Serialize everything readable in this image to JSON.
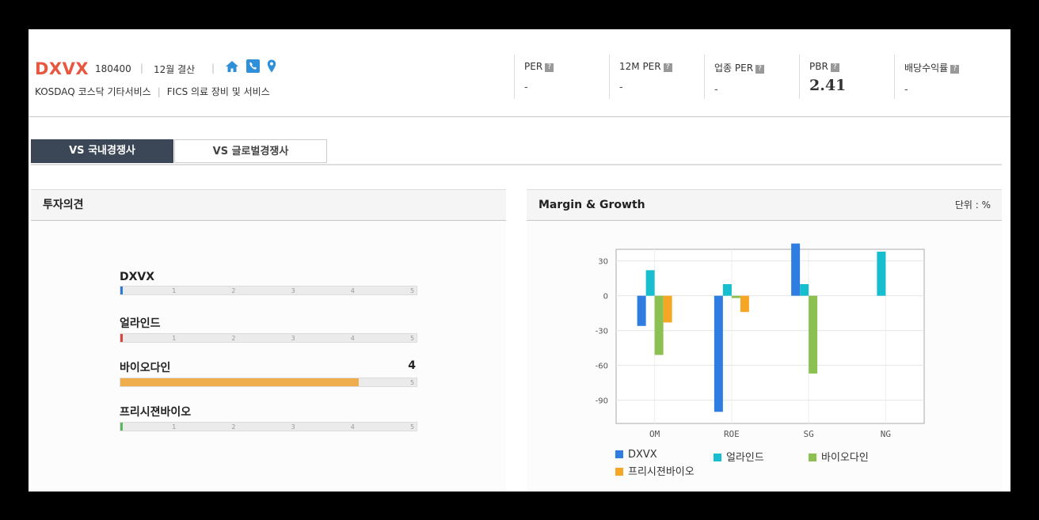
{
  "header": {
    "ticker": "DXVX",
    "code": "180400",
    "fiscal": "12월 결산",
    "market": "KOSDAQ  코스닥 기타서비스",
    "fics": "FICS 의료 장비 및 서비스",
    "icons": [
      "home-icon",
      "phone-icon",
      "location-pin-icon"
    ],
    "metrics": [
      {
        "label": "PER",
        "value": "-"
      },
      {
        "label": "12M PER",
        "value": "-"
      },
      {
        "label": "업종 PER",
        "value": "-"
      },
      {
        "label": "PBR",
        "value": "2.41"
      },
      {
        "label": "배당수익률",
        "value": "-"
      }
    ]
  },
  "tabs": [
    {
      "label": "VS 국내경쟁사",
      "active": true
    },
    {
      "label": "VS 글로벌경쟁사",
      "active": false
    }
  ],
  "opinion": {
    "title": "투자의견",
    "ticks": [
      "1",
      "2",
      "3",
      "4",
      "5"
    ],
    "companies": [
      {
        "name": "DXVX",
        "score": null,
        "score_label": "",
        "color": "#2f7ad6"
      },
      {
        "name": "얼라인드",
        "score": null,
        "score_label": "",
        "color": "#d9453d"
      },
      {
        "name": "바이오다인",
        "score": 4,
        "score_label": "4",
        "color": "#f0ad4e"
      },
      {
        "name": "프리시젼바이오",
        "score": null,
        "score_label": "",
        "color": "#5cb85c"
      }
    ]
  },
  "margin": {
    "title": "Margin & Growth",
    "unit": "단위 : %"
  },
  "chart_data": {
    "type": "bar",
    "categories": [
      "OM",
      "ROE",
      "SG",
      "NG"
    ],
    "ylim": [
      -110,
      40
    ],
    "yticks": [
      30,
      0,
      -30,
      -60,
      -90
    ],
    "grid": true,
    "legend": "bottom",
    "series": [
      {
        "name": "DXVX",
        "color": "#2f7de1",
        "values": [
          -26,
          -100,
          45,
          null
        ]
      },
      {
        "name": "얼라인드",
        "color": "#17becf",
        "values": [
          22,
          10,
          10,
          38
        ]
      },
      {
        "name": "바이오다인",
        "color": "#8cc152",
        "values": [
          -51,
          -2,
          -67,
          null
        ]
      },
      {
        "name": "프리시젼바이오",
        "color": "#f5a623",
        "values": [
          -23,
          -14,
          null,
          null
        ]
      }
    ]
  }
}
